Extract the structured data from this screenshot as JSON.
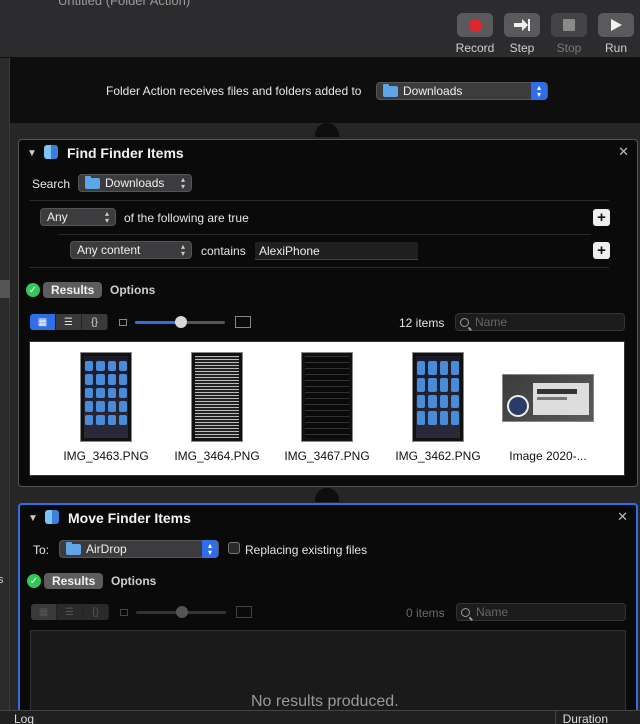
{
  "window": {
    "title": "Untitled (Folder Action)"
  },
  "toolbar": {
    "record": "Record",
    "step": "Step",
    "stop": "Stop",
    "run": "Run"
  },
  "sidebar": {
    "partial_text": "s"
  },
  "folder_action": {
    "label": "Folder Action receives files and folders added to",
    "folder": "Downloads"
  },
  "find_finder_items": {
    "title": "Find Finder Items",
    "search_label": "Search",
    "search_folder": "Downloads",
    "match_mode": "Any",
    "match_suffix": "of the following are true",
    "criterion_field": "Any content",
    "criterion_op": "contains",
    "criterion_value": "AlexiPhone",
    "tabs": {
      "results": "Results",
      "options": "Options"
    },
    "count": "12 items",
    "search_placeholder": "Name",
    "items": [
      {
        "name": "IMG_3463.PNG"
      },
      {
        "name": "IMG_3464.PNG"
      },
      {
        "name": "IMG_3467.PNG"
      },
      {
        "name": "IMG_3462.PNG"
      },
      {
        "name": "Image 2020-..."
      }
    ]
  },
  "move_finder_items": {
    "title": "Move Finder Items",
    "to_label": "To:",
    "destination": "AirDrop",
    "replacing_label": "Replacing existing files",
    "replacing_checked": false,
    "tabs": {
      "results": "Results",
      "options": "Options"
    },
    "count": "0 items",
    "search_placeholder": "Name",
    "empty_message": "No results produced."
  },
  "logbar": {
    "log": "Log",
    "duration": "Duration"
  },
  "colors": {
    "accent": "#2f6ee6",
    "success": "#34c759",
    "record": "#e0262b"
  }
}
